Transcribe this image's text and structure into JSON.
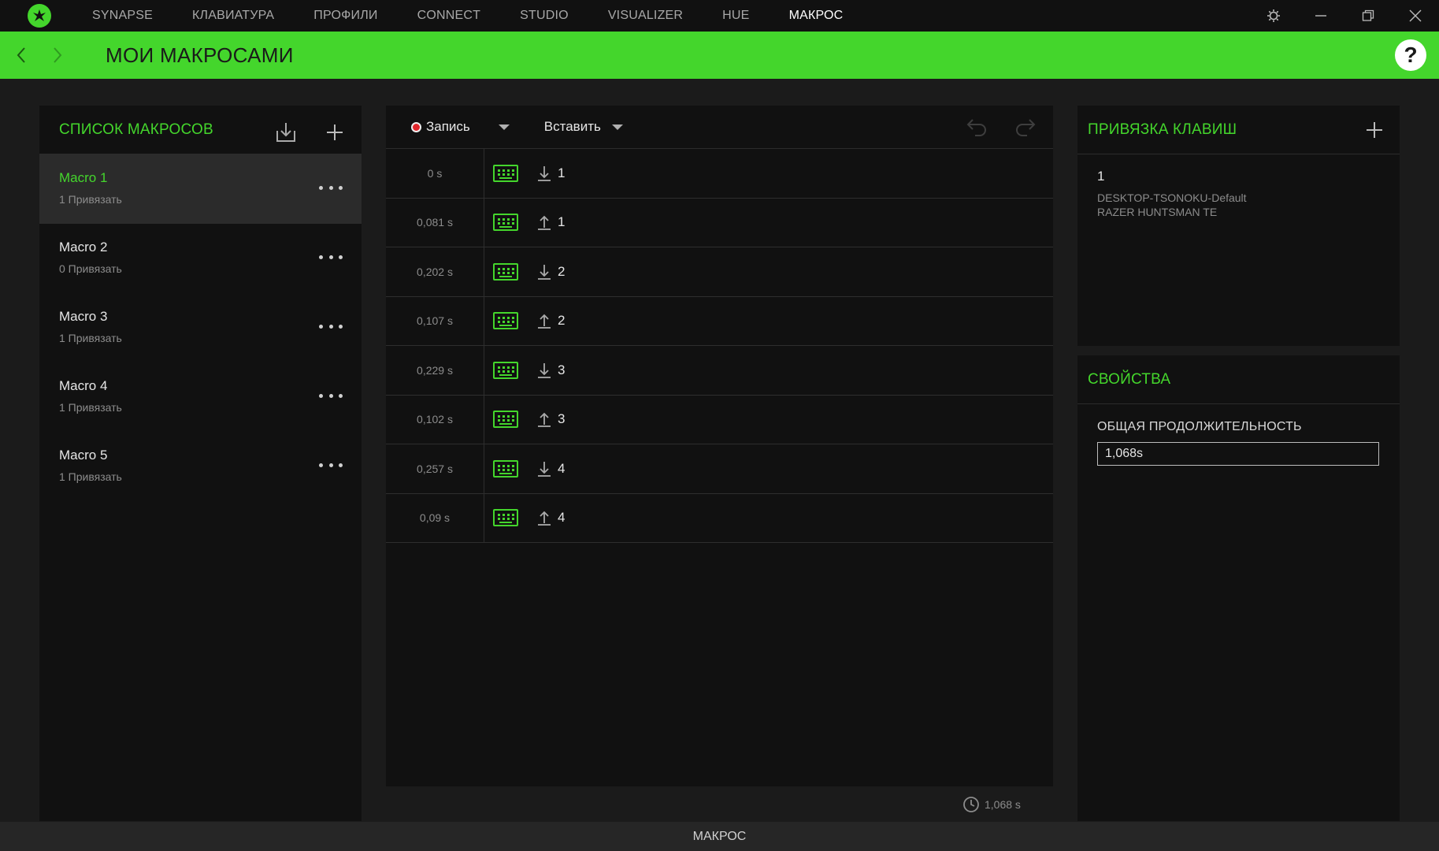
{
  "nav": {
    "tabs": [
      "SYNAPSE",
      "КЛАВИАТУРА",
      "ПРОФИЛИ",
      "CONNECT",
      "STUDIO",
      "VISUALIZER",
      "HUE",
      "МАКРОС"
    ],
    "active_index": 7
  },
  "header": {
    "title": "МОИ МАКРОСАМИ"
  },
  "macro_list": {
    "title": "СПИСОК МАКРОСОВ",
    "items": [
      {
        "name": "Macro 1",
        "bindings": "1 Привязать"
      },
      {
        "name": "Macro 2",
        "bindings": "0 Привязать"
      },
      {
        "name": "Macro 3",
        "bindings": "1 Привязать"
      },
      {
        "name": "Macro 4",
        "bindings": "1 Привязать"
      },
      {
        "name": "Macro 5",
        "bindings": "1 Привязать"
      }
    ],
    "selected_index": 0
  },
  "editor": {
    "record_label": "Запись",
    "insert_label": "Вставить",
    "steps": [
      {
        "delay": "0 s",
        "action": "press",
        "key": "1"
      },
      {
        "delay": "0,081 s",
        "action": "release",
        "key": "1"
      },
      {
        "delay": "0,202 s",
        "action": "press",
        "key": "2"
      },
      {
        "delay": "0,107 s",
        "action": "release",
        "key": "2"
      },
      {
        "delay": "0,229 s",
        "action": "press",
        "key": "3"
      },
      {
        "delay": "0,102 s",
        "action": "release",
        "key": "3"
      },
      {
        "delay": "0,257 s",
        "action": "press",
        "key": "4"
      },
      {
        "delay": "0,09 s",
        "action": "release",
        "key": "4"
      }
    ],
    "total_duration": "1,068 s"
  },
  "key_binding": {
    "title": "ПРИВЯЗКА КЛАВИШ",
    "key": "1",
    "profile": "DESKTOP-TSONOKU-Default",
    "device": "RAZER HUNTSMAN TE"
  },
  "properties": {
    "title": "СВОЙСТВА",
    "duration_label": "ОБЩАЯ ПРОДОЛЖИТЕЛЬНОСТЬ",
    "duration_value": "1,068s"
  },
  "footer": {
    "label": "МАКРОС"
  },
  "colors": {
    "accent": "#44d62c",
    "background": "#1b1b1b",
    "panel": "#111111",
    "record": "#e0262b"
  }
}
